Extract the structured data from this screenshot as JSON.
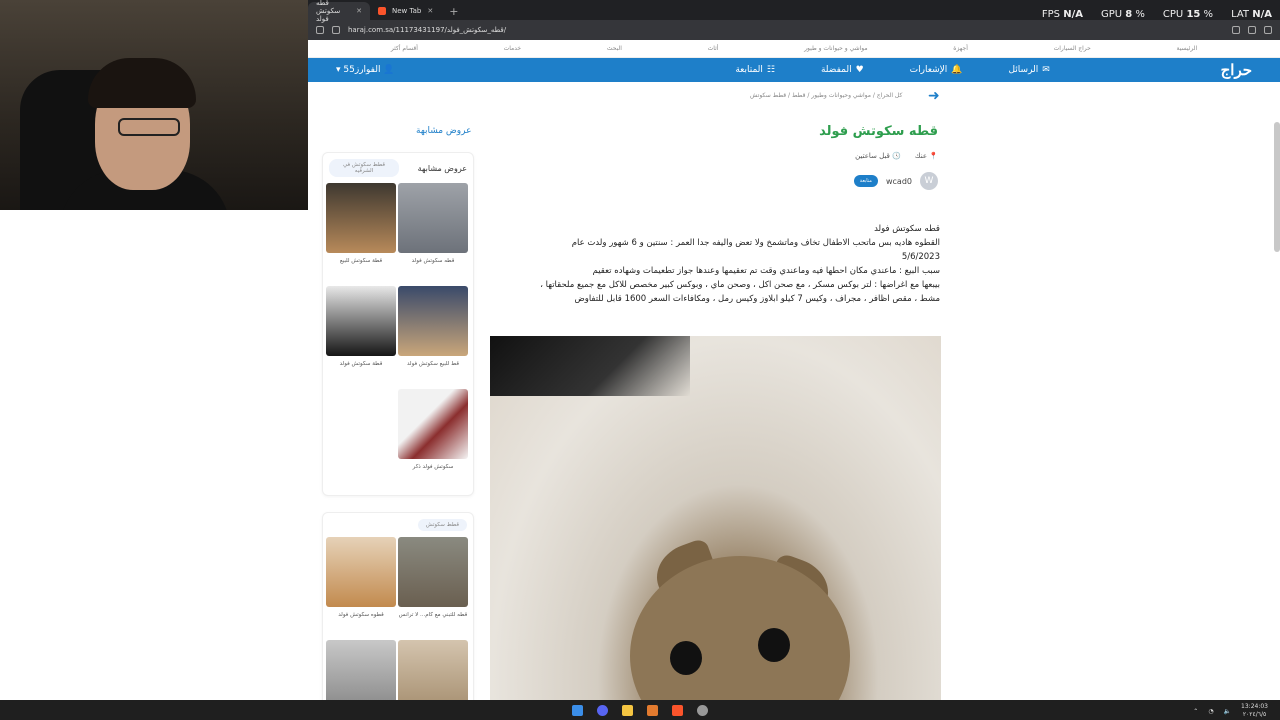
{
  "overlay": {
    "fps_label": "FPS",
    "fps_value": "N/A",
    "gpu_label": "GPU",
    "gpu_value": "8",
    "cpu_label": "CPU",
    "cpu_value": "15",
    "lat_label": "LAT",
    "lat_value": "N/A"
  },
  "tabs": [
    {
      "label": "قطه سكوتش فولد"
    },
    {
      "label": "New Tab"
    }
  ],
  "address": {
    "url": "haraj.com.sa/11173431197/قطه_سكوتش_فولد/"
  },
  "site_nav": [
    "الرئيسية",
    "حراج السيارات",
    "أجهزة",
    "مواشي و حيوانات و طيور",
    "أثاث",
    "البحث",
    "خدمات",
    "أقسام أكثر"
  ],
  "header": {
    "logo": "حراج",
    "menu": [
      "الرسائل",
      "الإشعارات",
      "المفضلة",
      "المتابعة"
    ],
    "user": "الفوارز55"
  },
  "breadcrumb": "كل الحراج / مواشي وحيوانات وطيور / قطط / قطط سكوتش",
  "post": {
    "title": "قطه سكوتش فولد",
    "location": "عنك",
    "time": "قبل ساعتين",
    "seller": "wcad0",
    "seller_initial": "W",
    "follow_label": "متابعة",
    "description": [
      "قطه سكوتش فولد",
      "القطوه هاديه بس ماتحب الاطفال تخاف وماتشمخ ولا تعض واليفه جدا العمر : سنتين و 6 شهور ولدت عام",
      "5/6/2023",
      "سبب البيع : ماعندي مكان احطها فيه وماعندي وقت تم تعقيمها وعندها جواز تطعيمات وشهاده تعقيم",
      "بيبعها مع اغراضها : لتر بوكس مسكر ، مع صحن اكل ، وصحن ماي ، وبوكس كبير مخصص للاكل مع جميع ملحقاتها ،",
      "مشط ، مقص اظافر ، مجراف ، وكيس 7 كيلو ابلاوز وكيس رمل ، ومكافاءات السعر 1600 قابل للتفاوض"
    ]
  },
  "sidebar": {
    "title": "عروض مشابهة",
    "card1": {
      "heading": "عروض مشابهة",
      "pill": "قطط سكوتش في الشرقيه",
      "items": [
        "قطه سكوتش فولد",
        "قطة سكوتش للبيع",
        "قط للبيع سكوتش فولد",
        "قطة سكوتش فولد",
        "سكوتش فولد ذكر"
      ]
    },
    "card2": {
      "pill": "قطط سكوتش",
      "items": [
        "قطه للتبني مع كام... لا ترانس",
        "قطوه سكوتش فولد",
        "",
        ""
      ]
    }
  },
  "taskbar": {
    "time": "13:24:03",
    "date": "٢٠٢٤/٦/٥"
  }
}
